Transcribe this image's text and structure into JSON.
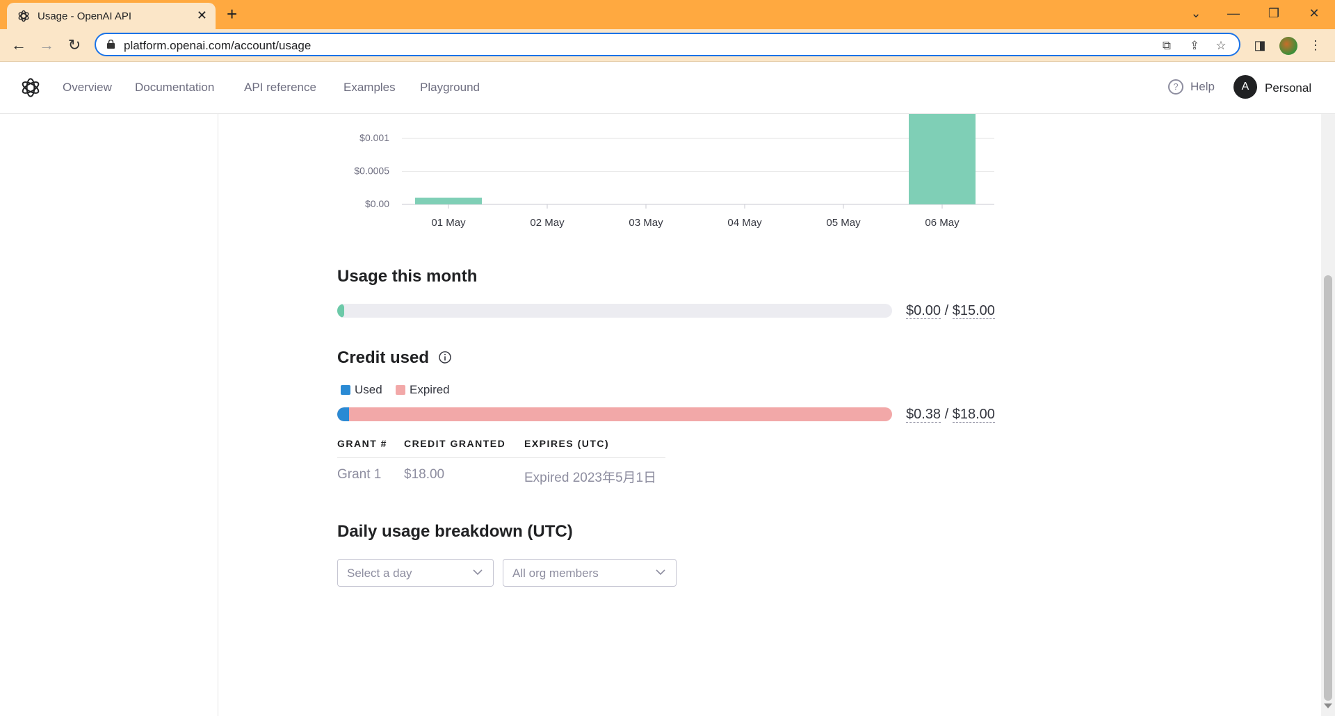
{
  "browser": {
    "tab_title": "Usage - OpenAI API",
    "url": "platform.openai.com/account/usage"
  },
  "header": {
    "nav": [
      "Overview",
      "Documentation",
      "API reference",
      "Examples",
      "Playground"
    ],
    "help_label": "Help",
    "avatar_initial": "A",
    "account_label": "Personal"
  },
  "chart_data": {
    "type": "bar",
    "categories": [
      "01 May",
      "02 May",
      "03 May",
      "04 May",
      "05 May",
      "06 May"
    ],
    "values": [
      0.0001,
      0,
      0,
      0,
      0,
      0.0016
    ],
    "yticks": [
      "$0.00",
      "$0.0005",
      "$0.001"
    ],
    "ytick_values": [
      0,
      0.0005,
      0.001
    ],
    "ylim": [
      0,
      0.0015
    ],
    "bar_color": "#7fcfb6",
    "grid": true
  },
  "usage_month": {
    "title": "Usage this month",
    "fraction": 0.005,
    "used": "$0.00",
    "separator": "/",
    "limit": "$15.00",
    "fill_color": "#6cc9a8",
    "track_color": "#ececf1"
  },
  "credit": {
    "title": "Credit used",
    "legend": [
      {
        "label": "Used",
        "color": "#2a8ad4"
      },
      {
        "label": "Expired",
        "color": "#f2a8a8"
      }
    ],
    "used_fraction": 0.021,
    "used": "$0.38",
    "separator": "/",
    "total": "$18.00",
    "table": {
      "headers": [
        "GRANT #",
        "CREDIT GRANTED",
        "EXPIRES (UTC)"
      ],
      "rows": [
        [
          "Grant 1",
          "$18.00",
          "Expired 2023年5月1日"
        ]
      ]
    }
  },
  "daily": {
    "title": "Daily usage breakdown (UTC)",
    "day_select": "Select a day",
    "member_select": "All org members"
  }
}
